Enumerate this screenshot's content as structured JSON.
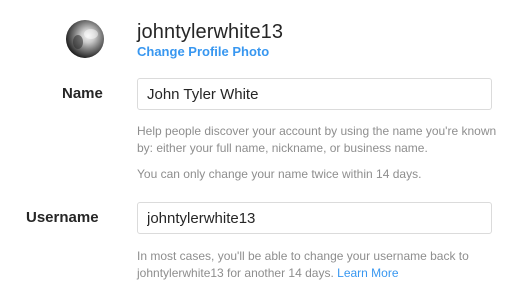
{
  "profile": {
    "username": "johntylerwhite13",
    "change_photo_label": "Change Profile Photo"
  },
  "form": {
    "name": {
      "label": "Name",
      "value": "John Tyler White",
      "help_line1": "Help people discover your account by using the name you're known by: either your full name, nickname, or business name.",
      "help_line2": "You can only change your name twice within 14 days."
    },
    "username": {
      "label": "Username",
      "value": "johntylerwhite13",
      "help_text": "In most cases, you'll be able to change your username back to johntylerwhite13 for another 14 days.",
      "learn_more_label": "Learn More"
    }
  },
  "colors": {
    "link": "#3897f0",
    "text": "#262626",
    "muted": "#8e8e8e",
    "border": "#dbdbdb"
  }
}
